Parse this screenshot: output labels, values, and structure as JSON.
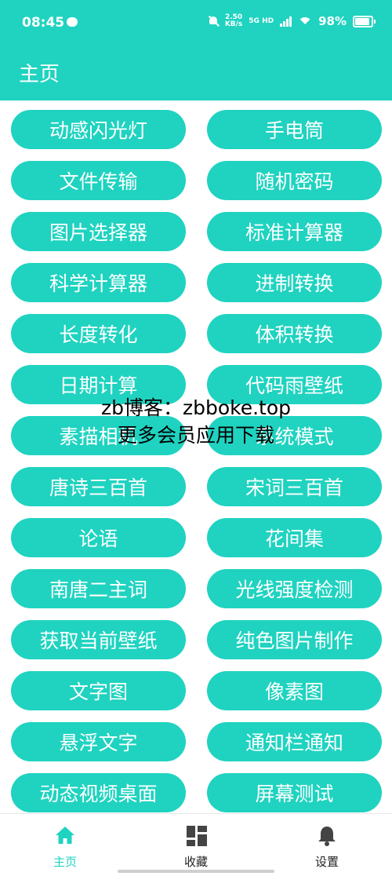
{
  "status_bar": {
    "time": "08:45",
    "speed_value": "2.50",
    "speed_unit": "KB/s",
    "network": "5G HD",
    "battery": "98%",
    "battery_level": 0.98
  },
  "app_bar": {
    "title": "主页"
  },
  "tools": [
    "动感闪光灯",
    "手电筒",
    "文件传输",
    "随机密码",
    "图片选择器",
    "标准计算器",
    "科学计算器",
    "进制转换",
    "长度转化",
    "体积转换",
    "日期计算",
    "代码雨壁纸",
    "素描相机",
    "系统模式",
    "唐诗三百首",
    "宋词三百首",
    "论语",
    "花间集",
    "南唐二主词",
    "光线强度检测",
    "获取当前壁纸",
    "纯色图片制作",
    "文字图",
    "像素图",
    "悬浮文字",
    "通知栏通知",
    "动态视频桌面",
    "屏幕测试"
  ],
  "watermark": {
    "line1": "zb博客：zbboke.top",
    "line2": "更多会员应用下载"
  },
  "bottom_nav": [
    {
      "label": "主页",
      "icon": "home-icon",
      "active": true
    },
    {
      "label": "收藏",
      "icon": "dashboard-icon",
      "active": false
    },
    {
      "label": "设置",
      "icon": "bell-icon",
      "active": false
    }
  ],
  "colors": {
    "accent": "#1fd3c0",
    "text_on_accent": "#ffffff"
  }
}
